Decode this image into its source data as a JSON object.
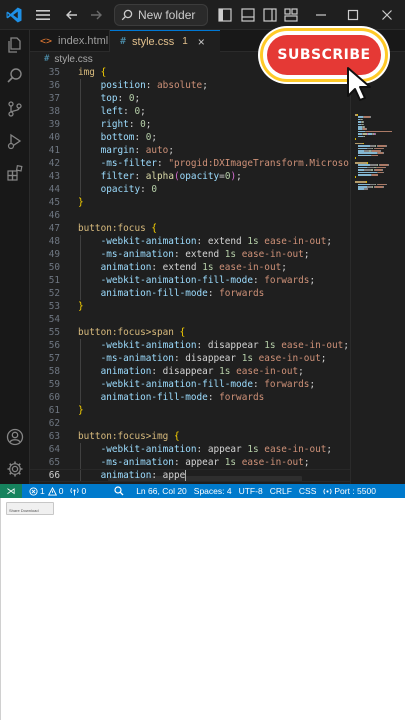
{
  "titlebar": {
    "search_label": "New folder"
  },
  "tabs": [
    {
      "icon": "<>",
      "label": "index.html"
    },
    {
      "icon": "#",
      "label": "style.css",
      "badge": "1",
      "close": "×"
    }
  ],
  "breadcrumb": {
    "icon": "#",
    "file": "style.css"
  },
  "editor": {
    "lines": [
      {
        "n": "35",
        "tokens": [
          [
            "img ",
            "k-sel"
          ],
          [
            "{",
            "k-brace"
          ]
        ]
      },
      {
        "n": "36",
        "tokens": [
          [
            "    position",
            "k-prop"
          ],
          [
            ": ",
            "k-pun"
          ],
          [
            "absolute",
            "k-val"
          ],
          [
            ";",
            "k-pun"
          ]
        ]
      },
      {
        "n": "37",
        "tokens": [
          [
            "    top",
            "k-prop"
          ],
          [
            ": ",
            "k-pun"
          ],
          [
            "0",
            "k-num"
          ],
          [
            ";",
            "k-pun"
          ]
        ]
      },
      {
        "n": "38",
        "tokens": [
          [
            "    left",
            "k-prop"
          ],
          [
            ": ",
            "k-pun"
          ],
          [
            "0",
            "k-num"
          ],
          [
            ";",
            "k-pun"
          ]
        ]
      },
      {
        "n": "39",
        "tokens": [
          [
            "    right",
            "k-prop"
          ],
          [
            ": ",
            "k-pun"
          ],
          [
            "0",
            "k-num"
          ],
          [
            ";",
            "k-pun"
          ]
        ]
      },
      {
        "n": "40",
        "tokens": [
          [
            "    bottom",
            "k-prop"
          ],
          [
            ": ",
            "k-pun"
          ],
          [
            "0",
            "k-num"
          ],
          [
            ";",
            "k-pun"
          ]
        ]
      },
      {
        "n": "41",
        "tokens": [
          [
            "    margin",
            "k-prop"
          ],
          [
            ": ",
            "k-pun"
          ],
          [
            "auto",
            "k-val"
          ],
          [
            ";",
            "k-pun"
          ]
        ]
      },
      {
        "n": "42",
        "tokens": [
          [
            "    -ms-filter",
            "k-prop"
          ],
          [
            ": ",
            "k-pun"
          ],
          [
            "\"progid:DXImageTransform.Microsoft.Al",
            "k-val"
          ]
        ]
      },
      {
        "n": "43",
        "tokens": [
          [
            "    filter",
            "k-prop"
          ],
          [
            ": ",
            "k-pun"
          ],
          [
            "alpha",
            "k-fn"
          ],
          [
            "(",
            "k-brace2"
          ],
          [
            "opacity",
            "k-prop"
          ],
          [
            "=",
            "k-pun"
          ],
          [
            "0",
            "k-num"
          ],
          [
            ")",
            "k-brace2"
          ],
          [
            ";",
            "k-pun"
          ]
        ]
      },
      {
        "n": "44",
        "tokens": [
          [
            "    opacity",
            "k-prop"
          ],
          [
            ": ",
            "k-pun"
          ],
          [
            "0",
            "k-num"
          ]
        ]
      },
      {
        "n": "45",
        "tokens": [
          [
            "}",
            "k-brace"
          ]
        ]
      },
      {
        "n": "46",
        "tokens": []
      },
      {
        "n": "47",
        "tokens": [
          [
            "button:focus ",
            "k-sel"
          ],
          [
            "{",
            "k-brace"
          ]
        ]
      },
      {
        "n": "48",
        "tokens": [
          [
            "    -webkit-animation",
            "k-prop"
          ],
          [
            ": ",
            "k-pun"
          ],
          [
            "extend ",
            "k-pun"
          ],
          [
            "1s",
            "k-num"
          ],
          [
            " ",
            "k-pun"
          ],
          [
            "ease-in-out",
            "k-val"
          ],
          [
            ";",
            "k-pun"
          ]
        ]
      },
      {
        "n": "49",
        "tokens": [
          [
            "    -ms-animation",
            "k-prop"
          ],
          [
            ": ",
            "k-pun"
          ],
          [
            "extend ",
            "k-pun"
          ],
          [
            "1s",
            "k-num"
          ],
          [
            " ",
            "k-pun"
          ],
          [
            "ease-in-out",
            "k-val"
          ],
          [
            ";",
            "k-pun"
          ]
        ]
      },
      {
        "n": "50",
        "tokens": [
          [
            "    animation",
            "k-prop"
          ],
          [
            ": ",
            "k-pun"
          ],
          [
            "extend ",
            "k-pun"
          ],
          [
            "1s",
            "k-num"
          ],
          [
            " ",
            "k-pun"
          ],
          [
            "ease-in-out",
            "k-val"
          ],
          [
            ";",
            "k-pun"
          ]
        ]
      },
      {
        "n": "51",
        "tokens": [
          [
            "    -webkit-animation-fill-mode",
            "k-prop"
          ],
          [
            ": ",
            "k-pun"
          ],
          [
            "forwards",
            "k-val"
          ],
          [
            ";",
            "k-pun"
          ]
        ]
      },
      {
        "n": "52",
        "tokens": [
          [
            "    animation-fill-mode",
            "k-prop"
          ],
          [
            ": ",
            "k-pun"
          ],
          [
            "forwards",
            "k-val"
          ]
        ]
      },
      {
        "n": "53",
        "tokens": [
          [
            "}",
            "k-brace"
          ]
        ]
      },
      {
        "n": "54",
        "tokens": []
      },
      {
        "n": "55",
        "tokens": [
          [
            "button:focus>span ",
            "k-sel"
          ],
          [
            "{",
            "k-brace"
          ]
        ]
      },
      {
        "n": "56",
        "tokens": [
          [
            "    -webkit-animation",
            "k-prop"
          ],
          [
            ": ",
            "k-pun"
          ],
          [
            "disappear ",
            "k-pun"
          ],
          [
            "1s",
            "k-num"
          ],
          [
            " ",
            "k-pun"
          ],
          [
            "ease-in-out",
            "k-val"
          ],
          [
            ";",
            "k-pun"
          ]
        ]
      },
      {
        "n": "57",
        "tokens": [
          [
            "    -ms-animation",
            "k-prop"
          ],
          [
            ": ",
            "k-pun"
          ],
          [
            "disappear ",
            "k-pun"
          ],
          [
            "1s",
            "k-num"
          ],
          [
            " ",
            "k-pun"
          ],
          [
            "ease-in-out",
            "k-val"
          ],
          [
            ";",
            "k-pun"
          ]
        ]
      },
      {
        "n": "58",
        "tokens": [
          [
            "    animation",
            "k-prop"
          ],
          [
            ": ",
            "k-pun"
          ],
          [
            "disappear ",
            "k-pun"
          ],
          [
            "1s",
            "k-num"
          ],
          [
            " ",
            "k-pun"
          ],
          [
            "ease-in-out",
            "k-val"
          ],
          [
            ";",
            "k-pun"
          ]
        ]
      },
      {
        "n": "59",
        "tokens": [
          [
            "    -webkit-animation-fill-mode",
            "k-prop"
          ],
          [
            ": ",
            "k-pun"
          ],
          [
            "forwards",
            "k-val"
          ],
          [
            ";",
            "k-pun"
          ]
        ]
      },
      {
        "n": "60",
        "tokens": [
          [
            "    animation-fill-mode",
            "k-prop"
          ],
          [
            ": ",
            "k-pun"
          ],
          [
            "forwards",
            "k-val"
          ]
        ]
      },
      {
        "n": "61",
        "tokens": [
          [
            "}",
            "k-brace"
          ]
        ]
      },
      {
        "n": "62",
        "tokens": []
      },
      {
        "n": "63",
        "tokens": [
          [
            "button:focus>img ",
            "k-sel"
          ],
          [
            "{",
            "k-brace"
          ]
        ]
      },
      {
        "n": "64",
        "tokens": [
          [
            "    -webkit-animation",
            "k-prop"
          ],
          [
            ": ",
            "k-pun"
          ],
          [
            "appear ",
            "k-pun"
          ],
          [
            "1s",
            "k-num"
          ],
          [
            " ",
            "k-pun"
          ],
          [
            "ease-in-out",
            "k-val"
          ],
          [
            ";",
            "k-pun"
          ]
        ]
      },
      {
        "n": "65",
        "tokens": [
          [
            "    -ms-animation",
            "k-prop"
          ],
          [
            ": ",
            "k-pun"
          ],
          [
            "appear ",
            "k-pun"
          ],
          [
            "1s",
            "k-num"
          ],
          [
            " ",
            "k-pun"
          ],
          [
            "ease-in-out",
            "k-val"
          ],
          [
            ";",
            "k-pun"
          ]
        ]
      },
      {
        "n": "66",
        "tokens": [
          [
            "    animation",
            "k-prop"
          ],
          [
            ": ",
            "k-pun"
          ],
          [
            "appe",
            "k-pun"
          ]
        ],
        "active": true
      }
    ]
  },
  "overlay": {
    "subscribe_label": "SUBSCRIBE"
  },
  "statusbar": {
    "remote": "⋊",
    "errors": "1",
    "warnings": "0",
    "ports_count": "0",
    "position": "Ln 66, Col 20",
    "spaces": "Spaces: 4",
    "encoding": "UTF-8",
    "eol": "CRLF",
    "language": "CSS",
    "port": "Port : 5500"
  },
  "preview": {
    "button_label": "Share Download"
  },
  "colors": {
    "statusbar": "#007acc",
    "editor_bg": "#1f1f1f",
    "accent": "#0078d4",
    "subscribe_red": "#e53935",
    "subscribe_border": "#ffca28"
  }
}
